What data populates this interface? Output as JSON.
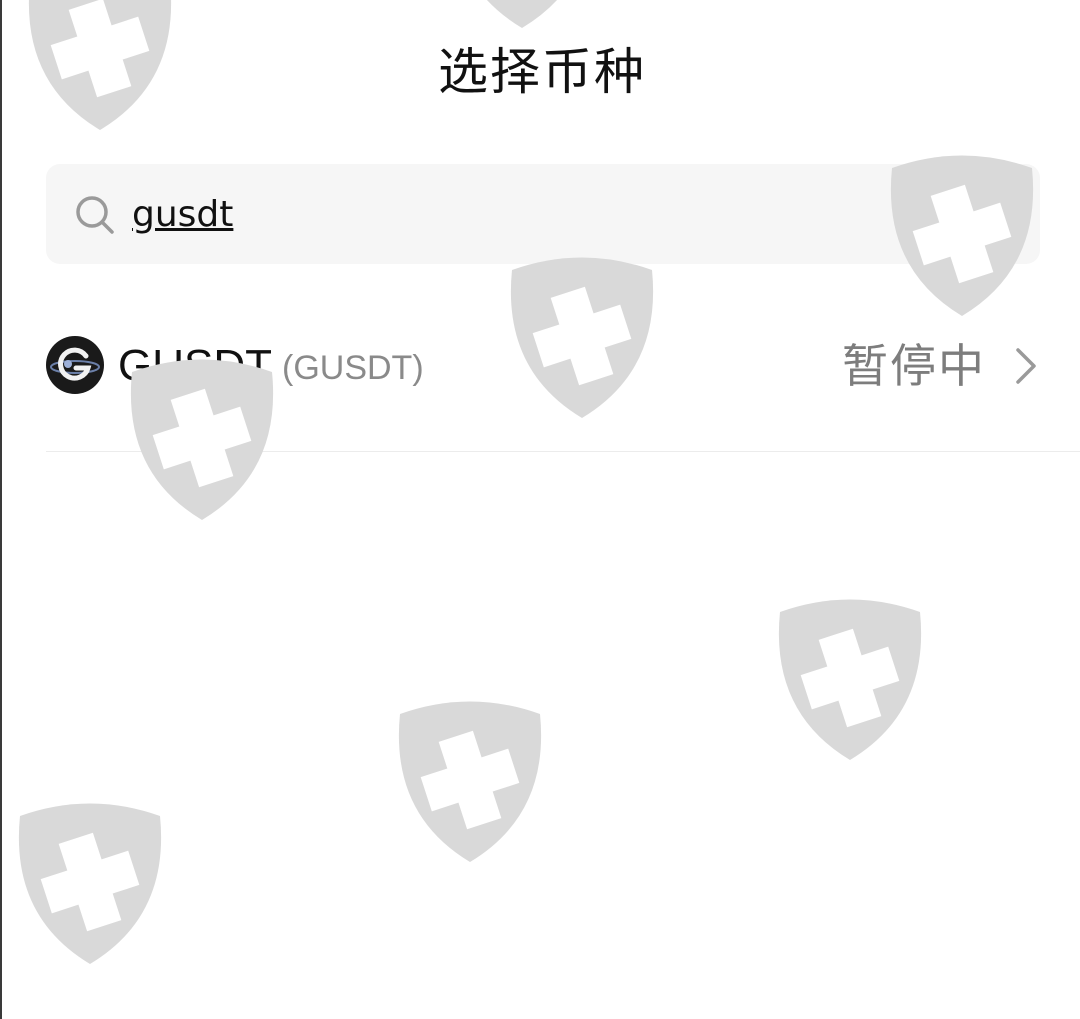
{
  "header": {
    "title": "选择币种",
    "back_icon": "back-arrow-icon"
  },
  "search": {
    "value": "gusdt",
    "search_icon": "search-icon",
    "clear_icon": "close-icon"
  },
  "coins": [
    {
      "name": "GUSDT",
      "symbol": "(GUSDT)",
      "status": "暂停中",
      "logo_icon": "gusdt-logo-icon",
      "chevron_icon": "chevron-right-icon"
    }
  ],
  "watermark": {
    "icon": "shield-cross-icon",
    "color": "#d9d9d9"
  },
  "colors": {
    "title": "#111111",
    "secondary_text": "#8a8a8a",
    "status_text": "#7d7d7d",
    "search_bg": "#f6f6f6",
    "divider": "#ececec"
  }
}
